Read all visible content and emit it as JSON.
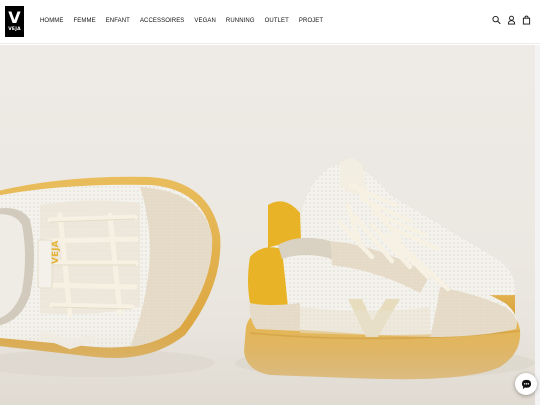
{
  "brand": {
    "logo_mark": "V",
    "logo_text": "VEJA"
  },
  "nav": {
    "items": [
      {
        "label": "HOMME"
      },
      {
        "label": "FEMME"
      },
      {
        "label": "ENFANT"
      },
      {
        "label": "ACCESSOIRES"
      },
      {
        "label": "VEGAN"
      },
      {
        "label": "RUNNING"
      },
      {
        "label": "OUTLET"
      },
      {
        "label": "PROJET"
      }
    ]
  },
  "header_icons": [
    "search-icon",
    "account-icon",
    "bag-icon"
  ],
  "hero": {
    "image": "two white mesh sneakers with beige suede panels, yellow heel tab and gum soles on a light background",
    "shoe_logo_text": "VEJA"
  },
  "chat": {
    "icon": "chat-icon"
  },
  "colors": {
    "accent": "#e6b021",
    "sole": "#e2b14f",
    "suede": "#e6dcc9",
    "background": "#ebe7e1"
  }
}
